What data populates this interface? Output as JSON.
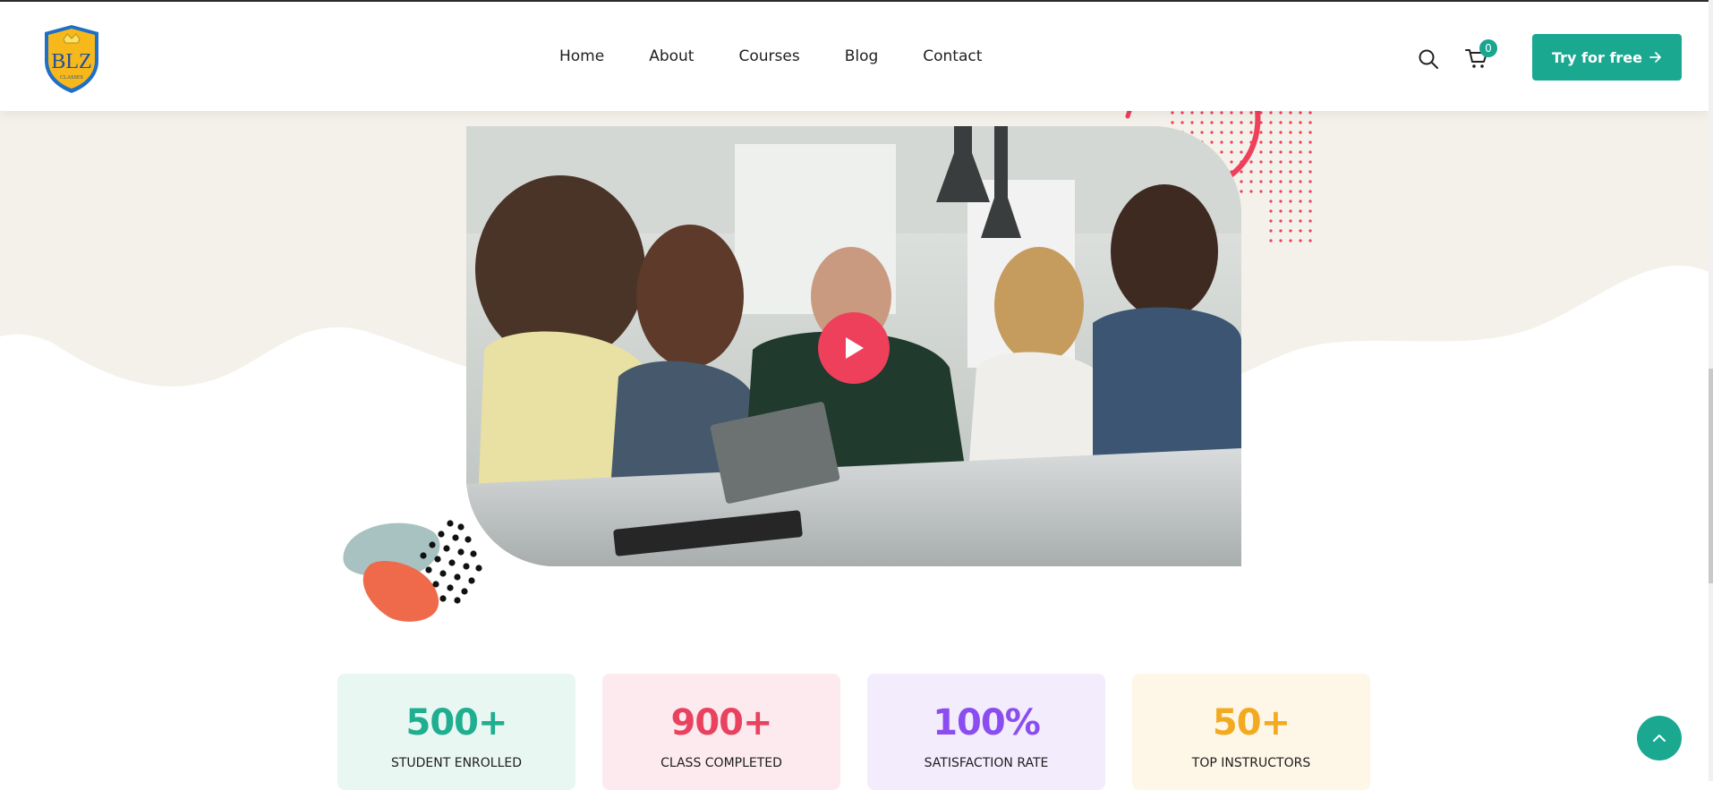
{
  "header": {
    "logo_text": "BLZ",
    "logo_subtext": "CLASSES",
    "nav": [
      "Home",
      "About",
      "Courses",
      "Blog",
      "Contact"
    ],
    "cart_count": "0",
    "cta_label": "Try for free"
  },
  "hero": {
    "video_alt": "Students collaborating around a table"
  },
  "stats": [
    {
      "value": "500+",
      "label": "STUDENT ENROLLED",
      "color": "#1fae8f",
      "bg": "#e9f7f3"
    },
    {
      "value": "900+",
      "label": "CLASS COMPLETED",
      "color": "#e9425f",
      "bg": "#fdeaee"
    },
    {
      "value": "100%",
      "label": "SATISFACTION RATE",
      "color": "#8a4ef0",
      "bg": "#f3ecfd"
    },
    {
      "value": "50+",
      "label": "TOP INSTRUCTORS",
      "color": "#f2aa20",
      "bg": "#fef6e6"
    }
  ],
  "colors": {
    "accent": "#1aa891",
    "play": "#ee3f5b",
    "hero_bg": "#f4f1ea"
  }
}
